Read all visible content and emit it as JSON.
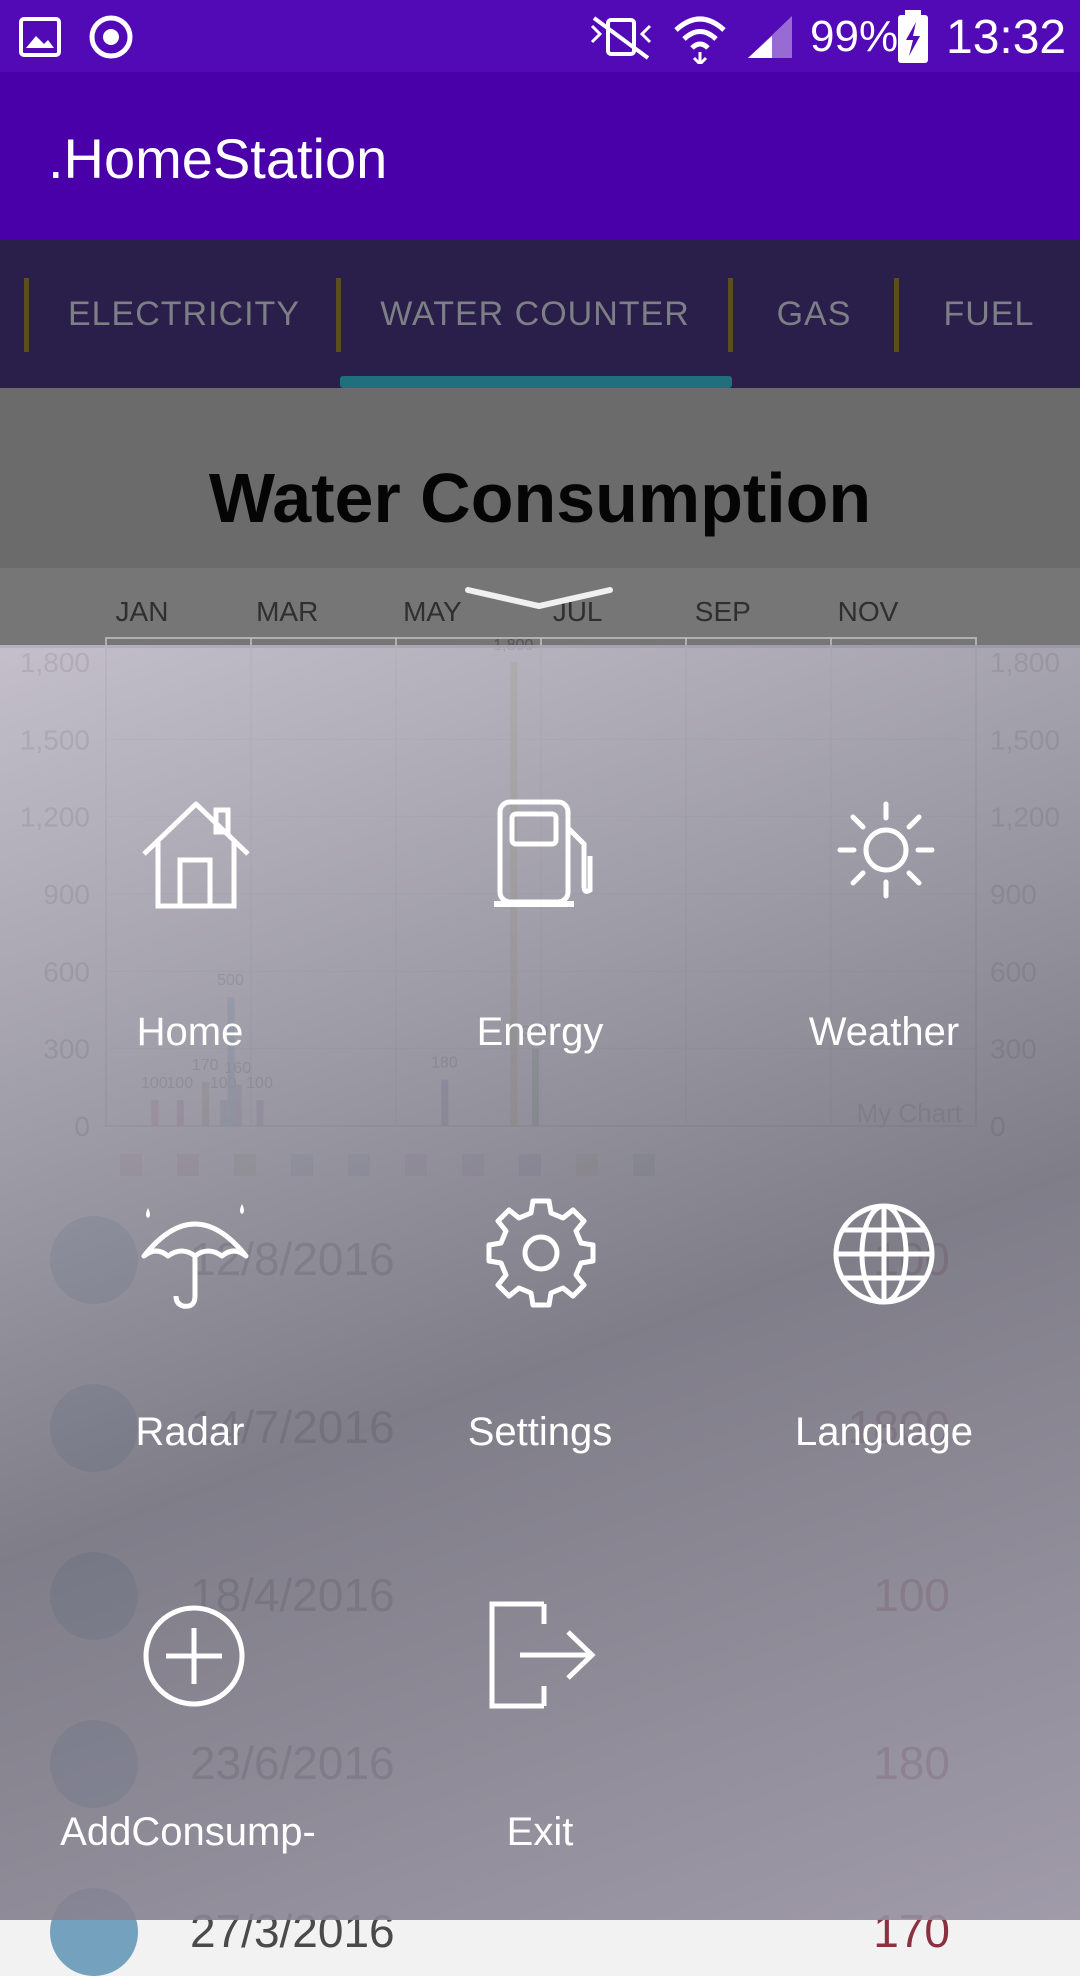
{
  "status_bar": {
    "battery": "99%",
    "time": "13:32"
  },
  "app_bar": {
    "title": ".HomeStation"
  },
  "tabs": [
    {
      "label": "ELECTRICITY"
    },
    {
      "label": "WATER COUNTER",
      "selected": true
    },
    {
      "label": "GAS"
    },
    {
      "label": "FUEL"
    }
  ],
  "chart_data": {
    "type": "bar",
    "title": "Water Consumption",
    "x_tick_labels": [
      "JAN",
      "MAR",
      "MAY",
      "JUL",
      "SEP",
      "NOV"
    ],
    "y_tick_labels": [
      "1,800",
      "1,500",
      "1,200",
      "900",
      "600",
      "300",
      "0"
    ],
    "ylim": [
      0,
      1800
    ],
    "grid": true,
    "legend_label": "My Chart",
    "bars": [
      {
        "x": 1.35,
        "value": 100,
        "label": "100",
        "color": "#c8507a"
      },
      {
        "x": 1.7,
        "value": 100,
        "label": "100",
        "color": "#b04a80"
      },
      {
        "x": 2.05,
        "value": 170,
        "label": "170",
        "color": "#8a8a30"
      },
      {
        "x": 2.3,
        "value": 100,
        "label": "100",
        "color": "#5b8aa8"
      },
      {
        "x": 2.4,
        "value": 500,
        "label": "500",
        "color": "#4a8ab0"
      },
      {
        "x": 2.5,
        "value": 160,
        "label": "160",
        "color": "#9a6ab0"
      },
      {
        "x": 2.8,
        "value": 100,
        "label": "100",
        "color": "#8a6ab0"
      },
      {
        "x": 5.35,
        "value": 180,
        "label": "180",
        "color": "#5a4aa0"
      },
      {
        "x": 6.3,
        "value": 1800,
        "label": "1,800",
        "color": "#a8a830"
      },
      {
        "x": 6.6,
        "value": 300,
        "label": "300",
        "color": "#4a7a40"
      }
    ]
  },
  "rows": [
    {
      "date": "12/8/2016",
      "value": "100"
    },
    {
      "date": "14/7/2016",
      "value": "1800"
    },
    {
      "date": "18/4/2016",
      "value": "100"
    },
    {
      "date": "23/6/2016",
      "value": "180"
    },
    {
      "date": "27/3/2016",
      "value": "170"
    }
  ],
  "menu": {
    "items": [
      {
        "label": "Home",
        "icon": "home-icon"
      },
      {
        "label": "Energy",
        "icon": "fuel-pump-icon"
      },
      {
        "label": "Weather",
        "icon": "sun-icon"
      },
      {
        "label": "Radar",
        "icon": "umbrella-icon"
      },
      {
        "label": "Settings",
        "icon": "gear-icon"
      },
      {
        "label": "Language",
        "icon": "globe-icon"
      },
      {
        "label": "AddConsump-",
        "icon": "add-circle-icon"
      },
      {
        "label": "Exit",
        "icon": "exit-icon"
      }
    ]
  },
  "colors": {
    "status_bar": "#5209b6",
    "app_bar": "#4a00a8",
    "tab_bar": "#2a1f4a",
    "tab_indicator": "#1f6f7e"
  }
}
